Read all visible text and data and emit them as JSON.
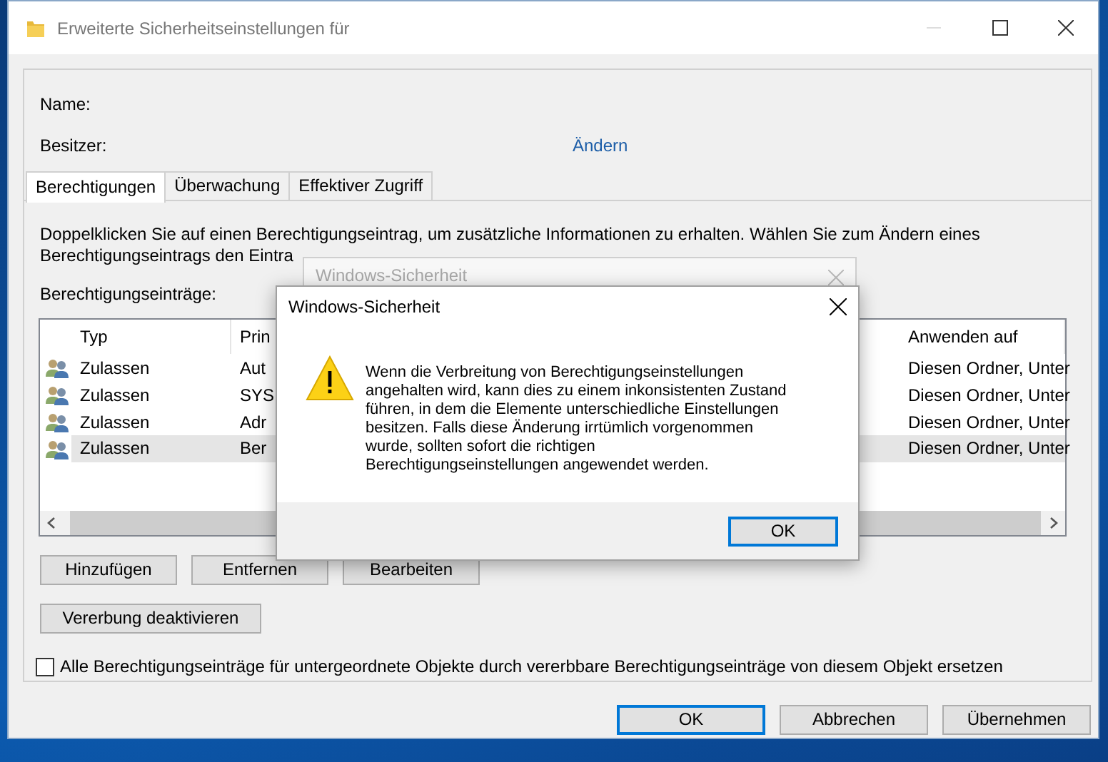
{
  "window": {
    "title": "Erweiterte Sicherheitseinstellungen für"
  },
  "name_label": "Name:",
  "owner_label": "Besitzer:",
  "owner_change_link": "Ändern",
  "tabs": [
    {
      "label": "Berechtigungen",
      "selected": true
    },
    {
      "label": "Überwachung",
      "selected": false
    },
    {
      "label": "Effektiver Zugriff",
      "selected": false
    }
  ],
  "description_lines": [
    "Doppelklicken Sie auf einen Berechtigungseintrag, um zusätzliche Informationen zu erhalten. Wählen Sie zum Ändern eines",
    "Berechtigungseintrags den Eintra"
  ],
  "entries_label": "Berechtigungseinträge:",
  "table": {
    "columns": [
      "Typ",
      "Prin",
      "Anwenden auf"
    ],
    "rows": [
      {
        "type": "Zulassen",
        "principal": "Aut",
        "applies_to": "Diesen Ordner, Unter",
        "selected": false
      },
      {
        "type": "Zulassen",
        "principal": "SYS",
        "applies_to": "Diesen Ordner, Unter",
        "selected": false
      },
      {
        "type": "Zulassen",
        "principal": "Adr",
        "applies_to": "Diesen Ordner, Unter",
        "selected": false
      },
      {
        "type": "Zulassen",
        "principal": "Ber",
        "applies_to": "Diesen Ordner, Unter",
        "selected": true
      }
    ]
  },
  "entry_buttons": [
    "Hinzufügen",
    "Entfernen",
    "Bearbeiten"
  ],
  "inheritance_button": "Vererbung deaktivieren",
  "replace_checkbox": {
    "label": "Alle Berechtigungseinträge für untergeordnete Objekte durch vererbbare Berechtigungseinträge von diesem Objekt ersetzen",
    "checked": false
  },
  "footer_buttons": [
    {
      "label": "OK",
      "default": true
    },
    {
      "label": "Abbrechen",
      "default": false
    },
    {
      "label": "Übernehmen",
      "default": false
    }
  ],
  "background_dialog": {
    "title": "Windows-Sicherheit"
  },
  "dialog": {
    "title": "Windows-Sicherheit",
    "message_lines": [
      "Wenn die Verbreitung von Berechtigungseinstellungen",
      "angehalten wird, kann dies zu einem inkonsistenten Zustand",
      "führen, in dem die Elemente unterschiedliche Einstellungen",
      "besitzen. Falls diese Änderung irrtümlich vorgenommen",
      "wurde, sollten sofort die richtigen",
      "Berechtigungseinstellungen angewendet werden."
    ],
    "button": {
      "label": "OK",
      "default": true
    }
  }
}
